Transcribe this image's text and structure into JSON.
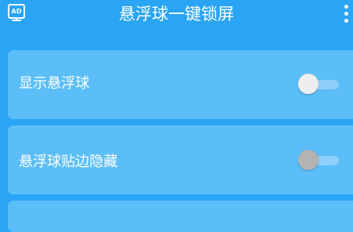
{
  "header": {
    "title": "悬浮球一键锁屏",
    "ad_badge": "AD",
    "ad_icon": "ad-monitor-icon",
    "menu_icon": "more-vertical-icon"
  },
  "settings": [
    {
      "label": "显示悬浮球",
      "enabled": true
    },
    {
      "label": "悬浮球贴边隐藏",
      "enabled": false
    }
  ],
  "colors": {
    "background": "#2aa4f5",
    "card": "#5cbef8",
    "switch_on_thumb": "#eeeeee",
    "switch_off_thumb": "#b3b3b3",
    "switch_track": "#8fd0fa"
  }
}
